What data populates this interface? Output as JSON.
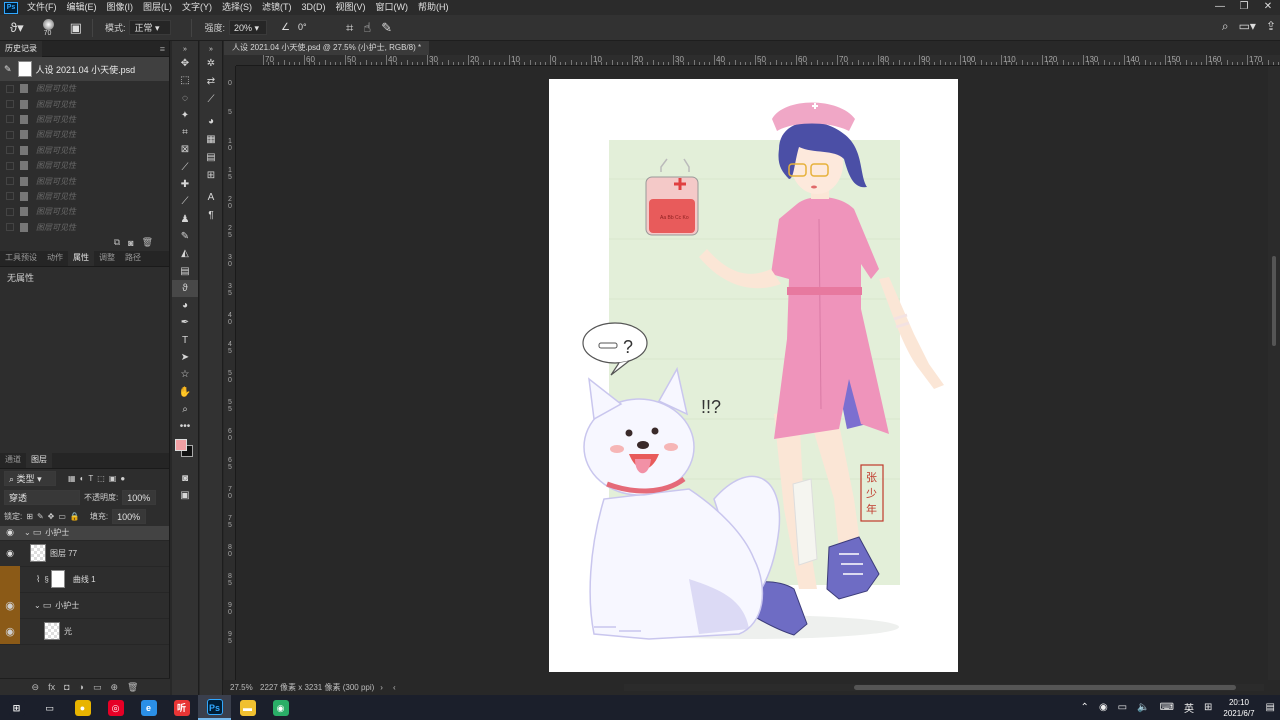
{
  "menubar": {
    "logo": "Ps",
    "items": [
      "文件(F)",
      "编辑(E)",
      "图像(I)",
      "图层(L)",
      "文字(Y)",
      "选择(S)",
      "滤镜(T)",
      "3D(D)",
      "视图(V)",
      "窗口(W)",
      "帮助(H)"
    ],
    "window_buttons": [
      "—",
      "❐",
      "✕"
    ]
  },
  "options": {
    "brush_size": "70",
    "mode_label": "模式:",
    "mode_value": "正常",
    "strength_label": "强度:",
    "strength_value": "20%",
    "angle_value": "0°"
  },
  "history": {
    "tab_label": "历史记录",
    "snapshot_name": "人设 2021.04 小天使.psd",
    "states": [
      "图层可见性",
      "图层可见性",
      "图层可见性",
      "图层可见性",
      "图层可见性",
      "图层可见性",
      "图层可见性",
      "图层可见性",
      "图层可见性",
      "图层可见性"
    ]
  },
  "props_panel": {
    "tabs": [
      "工具预设",
      "动作",
      "属性",
      "调整",
      "路径"
    ],
    "active_tab": "属性",
    "body_text": "无属性"
  },
  "layers_panel": {
    "tabs": [
      "通道",
      "图层"
    ],
    "active_tab": "图层",
    "filter_label": "类型",
    "blend_mode": "穿透",
    "opacity_label": "不透明度:",
    "opacity_value": "100%",
    "lock_label": "锁定:",
    "fill_label": "填充:",
    "fill_value": "100%",
    "layers": [
      {
        "name": "小护士",
        "kind": "group"
      },
      {
        "name": "图层 77",
        "kind": "pixel"
      },
      {
        "name": "曲线 1",
        "kind": "adjustment"
      },
      {
        "name": "小护士",
        "kind": "group"
      },
      {
        "name": "光",
        "kind": "pixel"
      }
    ]
  },
  "document": {
    "tab_title": "人设 2021.04 小天使.psd @ 27.5% (小护士, RGB/8) *",
    "ruler_labels": [
      "70",
      "60",
      "50",
      "40",
      "30",
      "20",
      "10",
      "0",
      "10",
      "20",
      "30",
      "40",
      "50",
      "60",
      "70",
      "80",
      "90",
      "100",
      "110",
      "120",
      "130",
      "140",
      "150",
      "160",
      "170"
    ],
    "vruler_labels": [
      "0",
      "5",
      "10",
      "15",
      "20",
      "25",
      "30",
      "35",
      "40",
      "45",
      "50",
      "55",
      "60",
      "65",
      "70",
      "75",
      "80",
      "85",
      "90",
      "95"
    ],
    "zoom": "27.5%",
    "dimensions": "2227 像素 x 3231 像素 (300 ppi)"
  },
  "artwork": {
    "speech_symbol": "?",
    "exclaim": "!!?",
    "bag_text": "Aa Bb Cc Ko",
    "seal_text": "张少年",
    "colors": {
      "background": "#e3efd9",
      "dress": "#ef94bb",
      "hair": "#4b4fa6",
      "shoes": "#6e6cc4",
      "dog_shadow": "#c9c6ee",
      "collar": "#e56a78",
      "seal": "#c0392b"
    }
  },
  "taskbar": {
    "apps": [
      {
        "name": "windows",
        "glyph": "⊞",
        "color": "#1b1f2b"
      },
      {
        "name": "task-view",
        "glyph": "▭",
        "color": "#1b1f2b"
      },
      {
        "name": "chrome",
        "glyph": "●",
        "color": "#e8b400"
      },
      {
        "name": "netease-music",
        "glyph": "◎",
        "color": "#e60026"
      },
      {
        "name": "browser",
        "glyph": "e",
        "color": "#2b8fe6"
      },
      {
        "name": "app-red",
        "glyph": "听",
        "color": "#e83535"
      },
      {
        "name": "photoshop",
        "glyph": "Ps",
        "color": "#001e36"
      },
      {
        "name": "file-explorer",
        "glyph": "▬",
        "color": "#f0c030"
      },
      {
        "name": "wechat",
        "glyph": "◉",
        "color": "#2aae67"
      }
    ],
    "ime": "英",
    "time": "20:10",
    "date": "2021/6/7"
  }
}
